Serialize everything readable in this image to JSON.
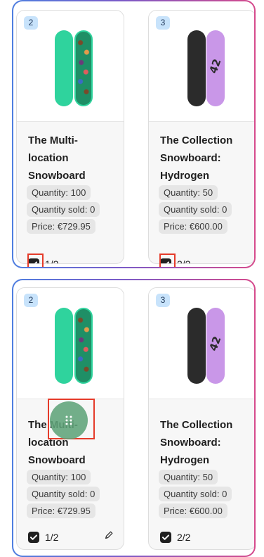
{
  "panels": [
    {
      "cards": [
        {
          "badge": "2",
          "title": "The Multi-location Snowboard",
          "quantity": "Quantity: 100",
          "quantity_sold": "Quantity sold: 0",
          "price": "Price: €729.95",
          "checked": true,
          "count": "1/2"
        },
        {
          "badge": "3",
          "title": "The Collection Snowboard: Hydrogen",
          "quantity": "Quantity: 50",
          "quantity_sold": "Quantity sold: 0",
          "price": "Price: €600.00",
          "checked": true,
          "count": "2/2"
        }
      ]
    },
    {
      "cards": [
        {
          "badge": "2",
          "title": "The Multi-location Snowboard",
          "quantity": "Quantity: 100",
          "quantity_sold": "Quantity sold: 0",
          "price": "Price: €729.95",
          "checked": true,
          "count": "1/2"
        },
        {
          "badge": "3",
          "title": "The Collection Snowboard: Hydrogen",
          "quantity": "Quantity: 50",
          "quantity_sold": "Quantity sold: 0",
          "price": "Price: €600.00",
          "checked": true,
          "count": "2/2"
        }
      ]
    }
  ],
  "colors": {
    "highlight": "#e53b2a",
    "drag_handle": "#60a47a",
    "badge_bg": "#c8e3fb",
    "gradient_start": "#4f7fe0",
    "gradient_end": "#d64a8c"
  },
  "icons": {
    "checkbox": "checkmark-icon",
    "drag": "drag-handle-icon",
    "edit": "pencil-icon"
  }
}
